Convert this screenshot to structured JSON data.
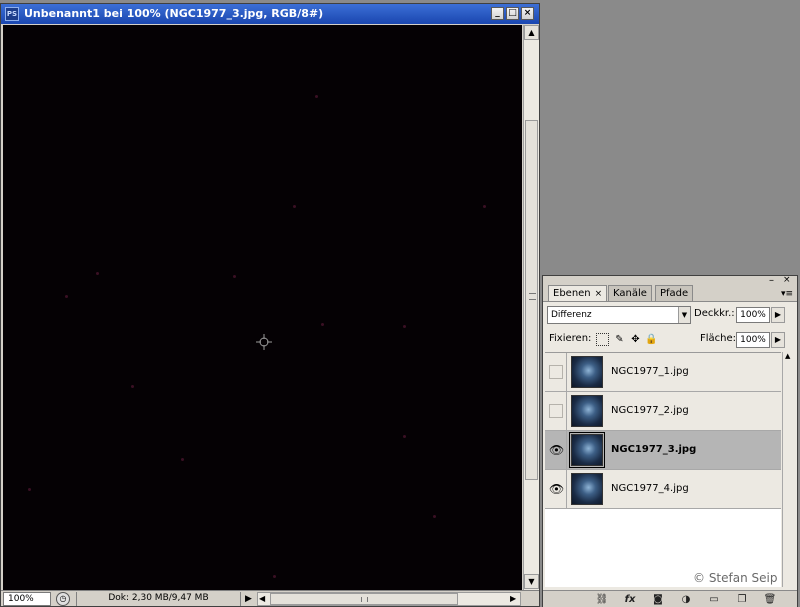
{
  "document": {
    "app_icon": "PS",
    "title": "Unbenannt1 bei 100% (NGC1977_3.jpg, RGB/8#)",
    "status": {
      "zoom": "100%",
      "doc_info": "Dok: 2,30 MB/9,47 MB"
    }
  },
  "layers_panel": {
    "tabs": [
      {
        "label": "Ebenen",
        "close": "×"
      },
      {
        "label": "Kanäle"
      },
      {
        "label": "Pfade"
      }
    ],
    "blend_mode": "Differenz",
    "opacity_label": "Deckkr.:",
    "opacity_value": "100%",
    "lock_label": "Fixieren:",
    "fill_label": "Fläche:",
    "fill_value": "100%",
    "layers": [
      {
        "name": "NGC1977_1.jpg",
        "visible": false,
        "selected": false
      },
      {
        "name": "NGC1977_2.jpg",
        "visible": false,
        "selected": false
      },
      {
        "name": "NGC1977_3.jpg",
        "visible": true,
        "selected": true
      },
      {
        "name": "NGC1977_4.jpg",
        "visible": true,
        "selected": false
      }
    ],
    "watermark": "© Stefan Seip"
  },
  "colors": {
    "titlebar": "#2a5bc4",
    "canvas": "#050104",
    "selected_layer": "#b5b5b5",
    "workspace": "#8a8a8a"
  }
}
